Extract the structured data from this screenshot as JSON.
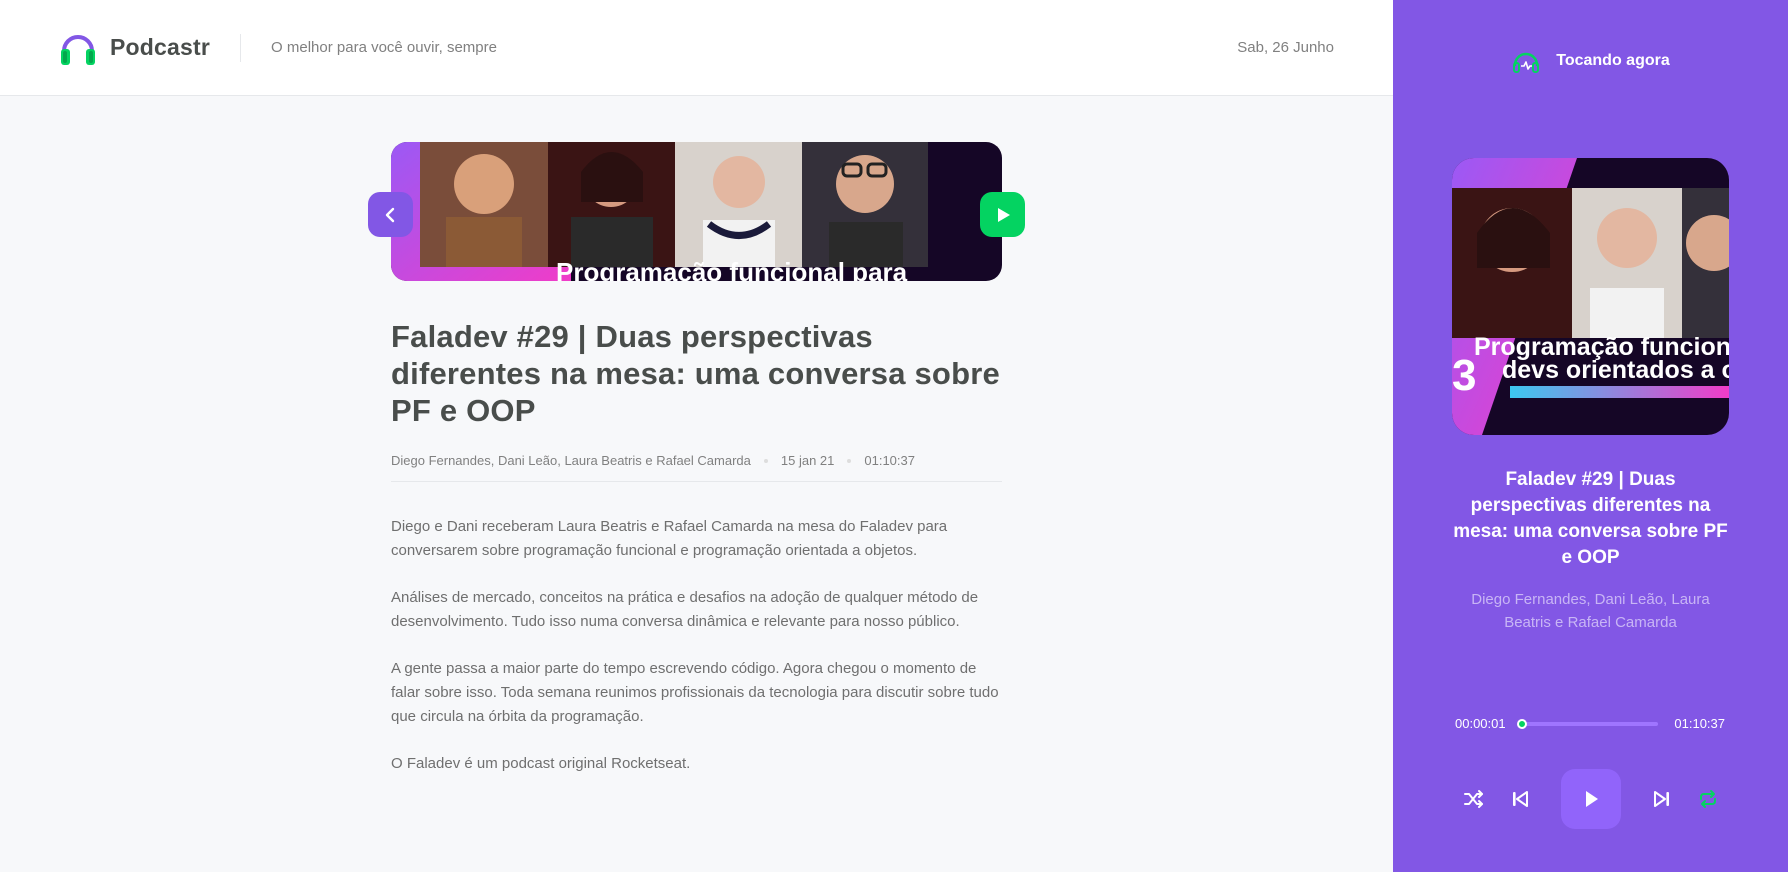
{
  "header": {
    "brand": "Podcastr",
    "tagline": "O melhor para você ouvir, sempre",
    "date": "Sab, 26 Junho"
  },
  "episode": {
    "thumbnail_caption": "Programação funcional para",
    "title": "Faladev #29 | Duas perspectivas diferentes na mesa: uma conversa sobre PF e OOP",
    "members": "Diego Fernandes, Dani Leão, Laura Beatris e Rafael Camarda",
    "published_at": "15 jan 21",
    "duration": "01:10:37",
    "description": [
      "Diego e Dani receberam Laura Beatris e Rafael Camarda na mesa do Faladev para conversarem sobre programação funcional e programação orientada a objetos.",
      "Análises de mercado, conceitos na prática e desafios na adoção de qualquer método de desenvolvimento. Tudo isso numa conversa dinâmica e relevante para nosso público.",
      "A gente passa a maior parte do tempo escrevendo código. Agora chegou o momento de falar sobre isso. Toda semana reunimos profissionais da tecnologia para discutir sobre tudo que circula na órbita da programação.",
      "O Faladev é um podcast original Rocketseat."
    ]
  },
  "player": {
    "heading": "Tocando agora",
    "cover_caption_line1": "Programação funcion",
    "cover_caption_line2": "devs orientados a o",
    "title": "Faladev #29 | Duas perspectivas diferentes na mesa: uma conversa sobre PF e OOP",
    "members": "Diego Fernandes, Dani Leão, Laura Beatris e Rafael Camarda",
    "current_time": "00:00:01",
    "total_time": "01:10:37",
    "progress_fraction": 0.0002
  },
  "colors": {
    "primary": "#8257e5",
    "green": "#04d361",
    "text_title": "#494d4b",
    "text_muted": "#808080"
  },
  "icons": {
    "back": "chevron-left-icon",
    "play": "play-icon",
    "shuffle": "shuffle-icon",
    "previous": "skip-previous-icon",
    "next": "skip-next-icon",
    "repeat": "repeat-icon",
    "playing_now": "headphones-icon"
  }
}
